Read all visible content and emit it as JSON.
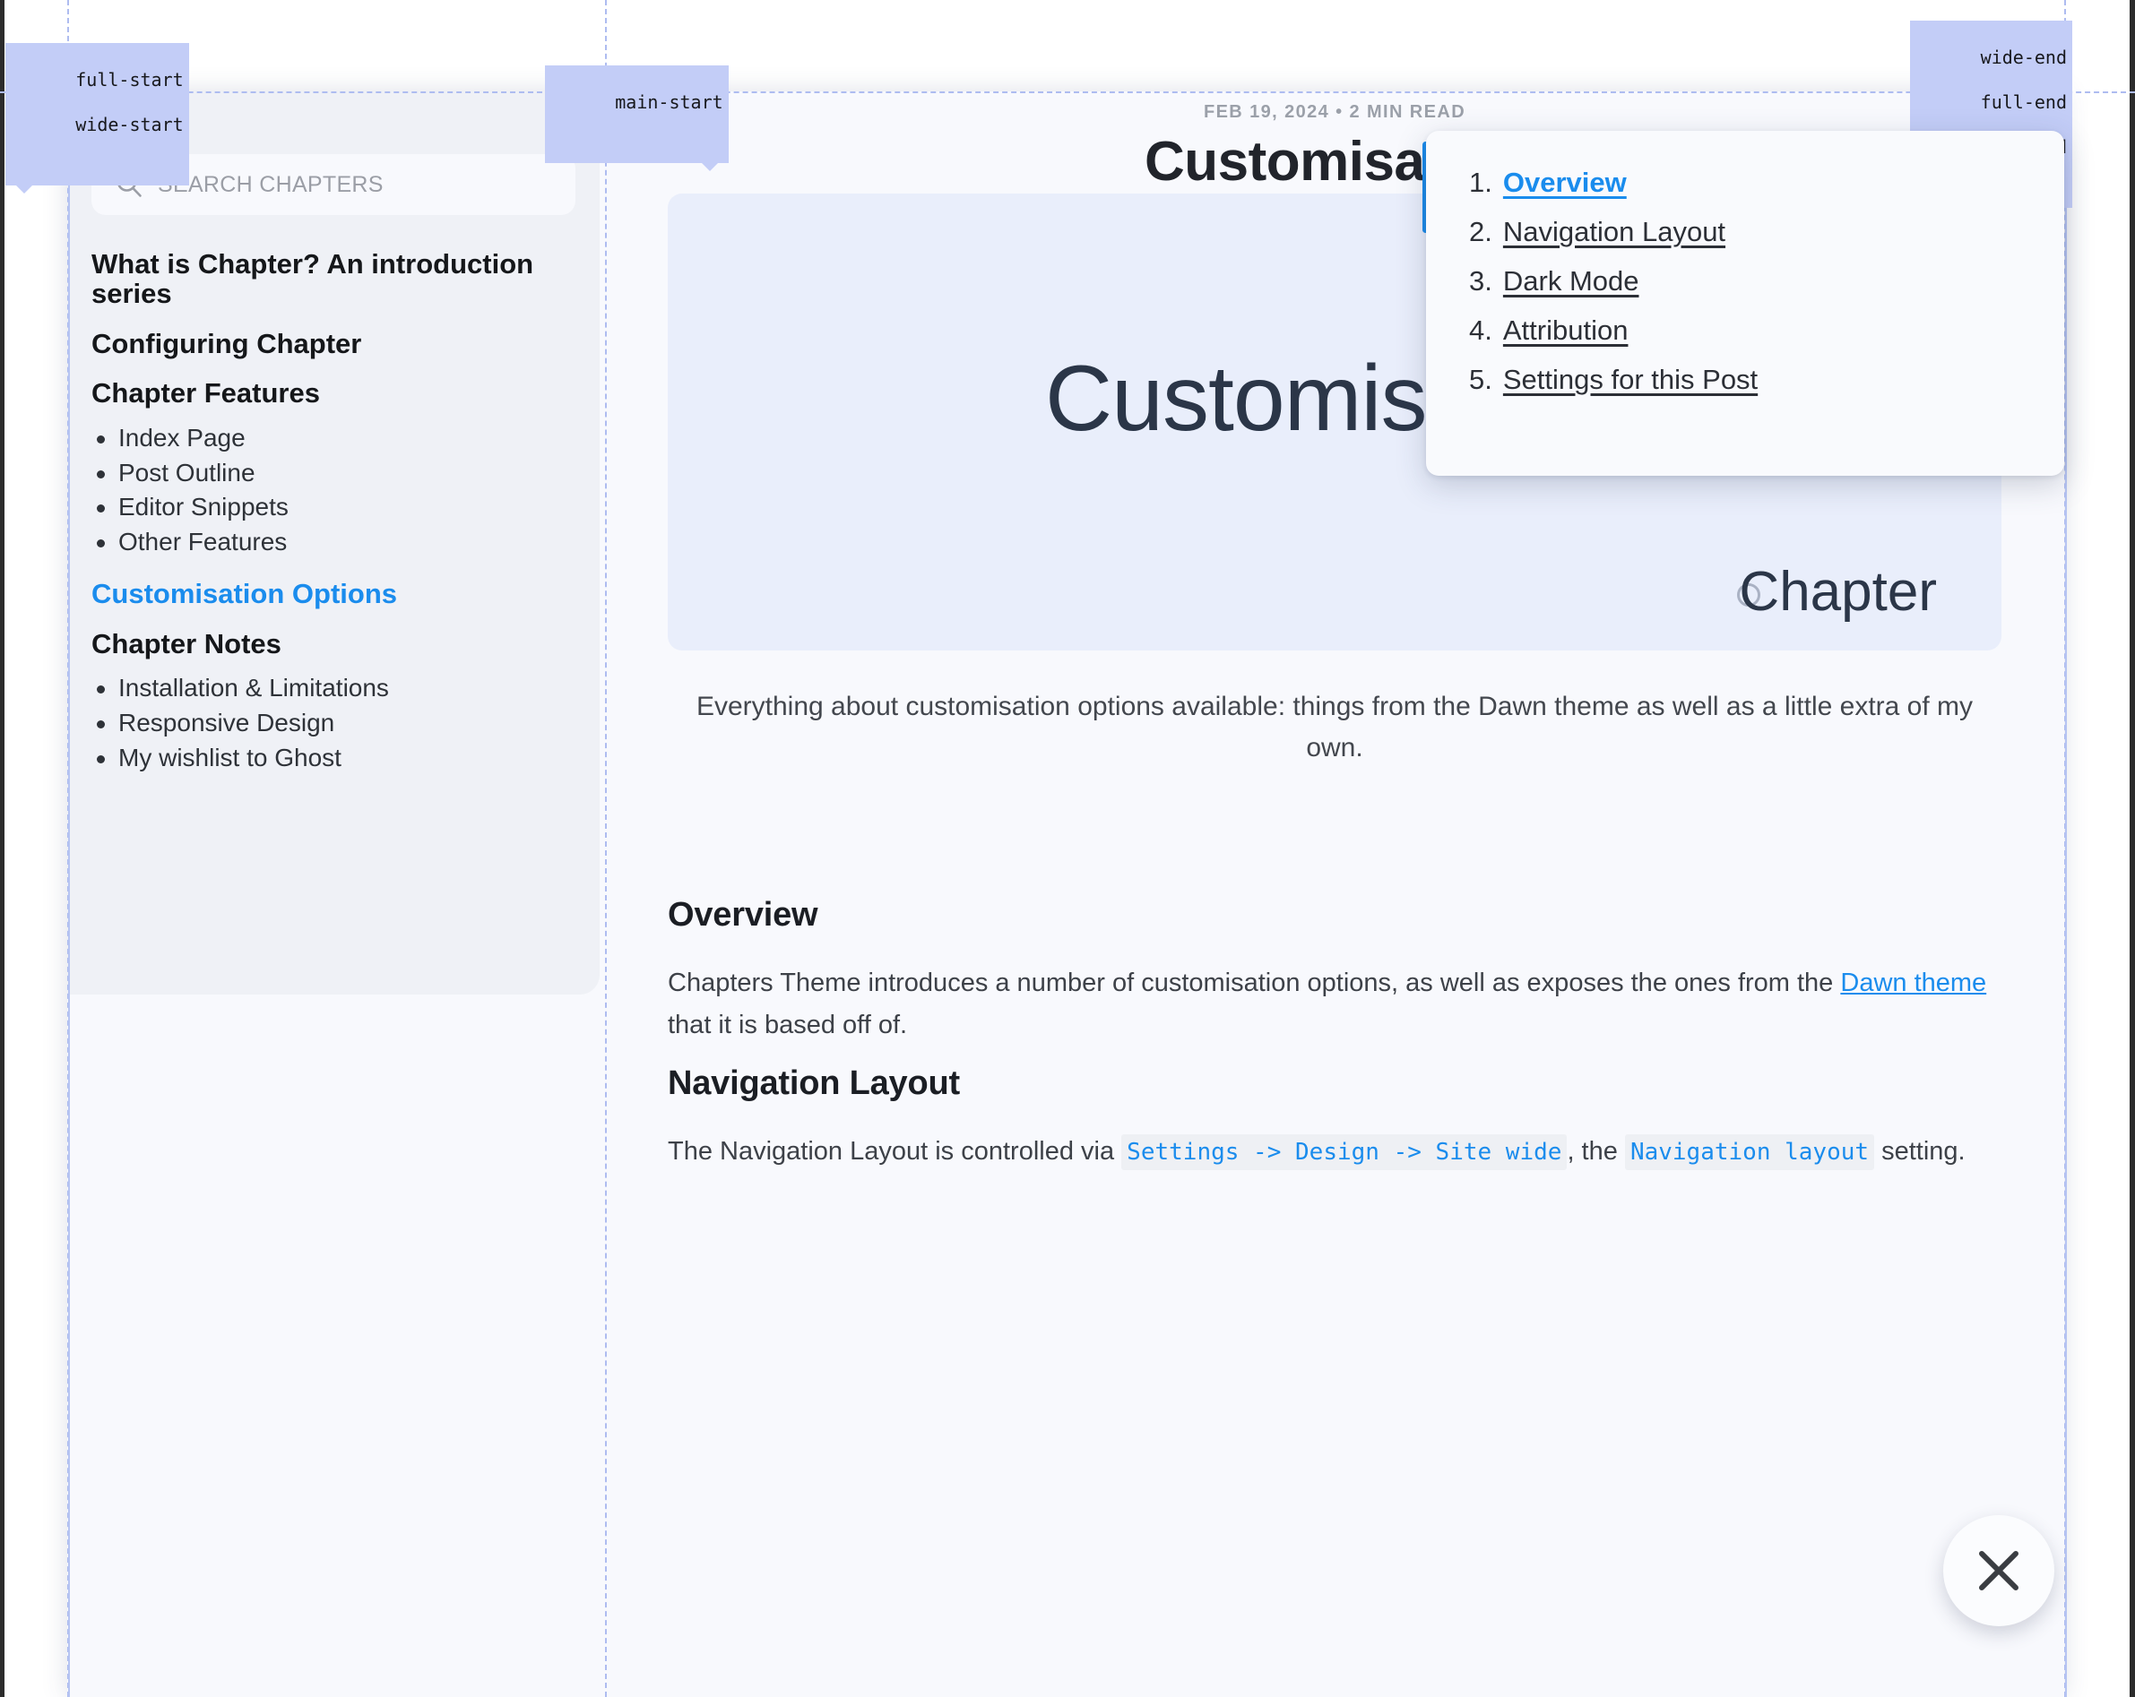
{
  "devtools_grid": {
    "labels": [
      {
        "lines": [
          "full-start",
          "wide-start"
        ]
      },
      {
        "lines": [
          "main-start"
        ]
      },
      {
        "lines": [
          "wide-end",
          "full-end",
          "main-end"
        ]
      }
    ],
    "line_color": "#aebcf0",
    "label_bg": "#c3cdf7"
  },
  "sidebar": {
    "search": {
      "icon": "search-icon",
      "placeholder": "SEARCH CHAPTERS",
      "value": ""
    },
    "items": [
      {
        "label": "What is Chapter? An introduction series",
        "active": false,
        "children": []
      },
      {
        "label": "Configuring Chapter",
        "active": false,
        "children": []
      },
      {
        "label": "Chapter Features",
        "active": false,
        "children": [
          "Index Page",
          "Post Outline",
          "Editor Snippets",
          "Other Features"
        ]
      },
      {
        "label": "Customisation Options",
        "active": true,
        "children": []
      },
      {
        "label": "Chapter Notes",
        "active": false,
        "children": [
          "Installation & Limitations",
          "Responsive Design",
          "My wishlist to Ghost"
        ]
      }
    ]
  },
  "post": {
    "meta": "FEB 19, 2024  •  2 MIN READ",
    "title": "Customisation",
    "feature_image": {
      "title": "Customisation",
      "logo": "Chapter"
    },
    "excerpt": "Everything about customisation options available: things from the Dawn theme as well as a little extra of my own.",
    "sections": [
      {
        "heading": "Overview",
        "paragraph_parts": [
          {
            "type": "text",
            "text": "Chapters Theme introduces a number of customisation options, as well as exposes the ones from the "
          },
          {
            "type": "link",
            "text": "Dawn theme"
          },
          {
            "type": "text",
            "text": " that it is based off of."
          }
        ]
      },
      {
        "heading": "Navigation Layout",
        "paragraph_parts": [
          {
            "type": "text",
            "text": "The Navigation Layout is controlled via "
          },
          {
            "type": "code",
            "text": "Settings -> Design -> Site wide"
          },
          {
            "type": "text",
            "text": ", the "
          },
          {
            "type": "code",
            "text": "Navigation layout"
          },
          {
            "type": "text",
            "text": " setting."
          }
        ]
      }
    ]
  },
  "toc": {
    "items": [
      {
        "label": "Overview",
        "active": true
      },
      {
        "label": "Navigation Layout",
        "active": false
      },
      {
        "label": "Dark Mode",
        "active": false
      },
      {
        "label": "Attribution",
        "active": false
      },
      {
        "label": "Settings for this Post",
        "active": false
      }
    ]
  },
  "close_button": {
    "icon": "close-icon",
    "label": "Close"
  },
  "colors": {
    "accent": "#1a8ced",
    "page_bg": "#f8f9fd",
    "sidebar_bg": "#eff1f6",
    "feature_bg": "#e9eefb",
    "text": "#21242b",
    "muted": "#9ba0a9",
    "code_bg": "#eef0f4"
  }
}
